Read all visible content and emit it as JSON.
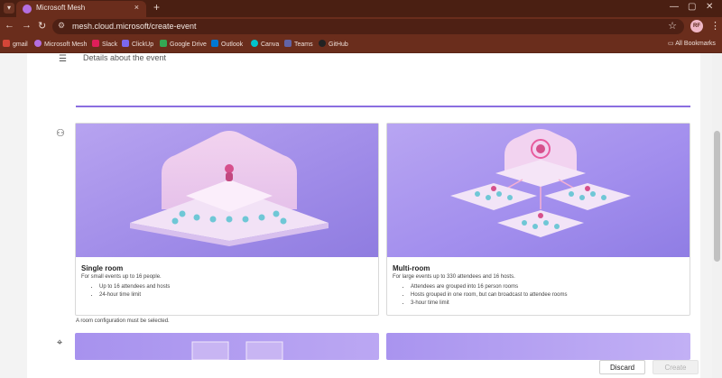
{
  "browser": {
    "tab_title": "Microsoft Mesh",
    "tab_close": "×",
    "new_tab": "+",
    "url": "mesh.cloud.microsoft/create-event",
    "profile_initials": "RF",
    "window_controls": [
      "—",
      "▢",
      "✕"
    ]
  },
  "bookmarks": [
    {
      "label": "gmail",
      "icon": "gmail-icon",
      "color": "#d44638"
    },
    {
      "label": "Microsoft Mesh",
      "icon": "mesh-icon",
      "color": "#b46fe0"
    },
    {
      "label": "Slack",
      "icon": "slack-icon",
      "color": "#e01e5a"
    },
    {
      "label": "ClickUp",
      "icon": "clickup-icon",
      "color": "#7b68ee"
    },
    {
      "label": "Google Drive",
      "icon": "drive-icon",
      "color": "#34a853"
    },
    {
      "label": "Outlook",
      "icon": "outlook-icon",
      "color": "#0078d4"
    },
    {
      "label": "Canva",
      "icon": "canva-icon",
      "color": "#00c4cc"
    },
    {
      "label": "Teams",
      "icon": "teams-icon",
      "color": "#6264a7"
    },
    {
      "label": "GitHub",
      "icon": "github-icon",
      "color": "#222222"
    }
  ],
  "all_bookmarks": "All Bookmarks",
  "form": {
    "description_placeholder": "Details about the event"
  },
  "rooms": [
    {
      "title": "Single room",
      "subtitle": "For small events up to 16 people.",
      "bullets": [
        "Up to 16 attendees and hosts",
        "24-hour time limit"
      ]
    },
    {
      "title": "Multi-room",
      "subtitle": "For large events up to 330 attendees and 16 hosts.",
      "bullets": [
        "Attendees are grouped into 16 person rooms",
        "Hosts grouped in one room, but can broadcast to attendee rooms",
        "3-hour time limit"
      ]
    }
  ],
  "validation_message": "A room configuration must be selected.",
  "actions": {
    "discard": "Discard",
    "create": "Create"
  },
  "colors": {
    "chrome_dark": "#4a1f12",
    "chrome": "#6a2d1c",
    "accent": "#8a6ee0"
  }
}
